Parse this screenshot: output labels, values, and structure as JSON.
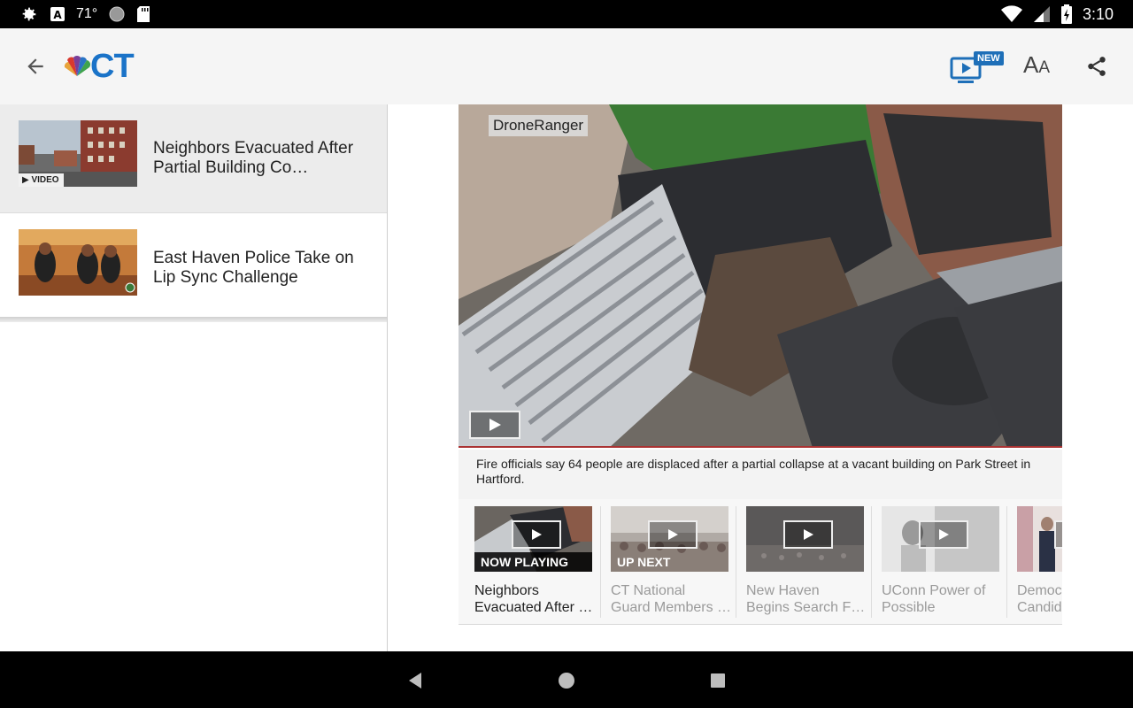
{
  "status_bar": {
    "temperature": "71°",
    "time": "3:10"
  },
  "app_bar": {
    "logo_text": "CT",
    "new_badge": "NEW",
    "font_size_big": "A",
    "font_size_small": "A"
  },
  "articles": [
    {
      "title": "Neighbors Evacuated After Partial Building Co…",
      "tag": "VIDEO",
      "active": true
    },
    {
      "title": "East Haven Police Take on Lip Sync Challenge",
      "active": false
    }
  ],
  "video": {
    "overlay_label": "DroneRanger",
    "caption": "Fire officials say 64 people are displaced after a partial collapse at a vacant building on Park Street in Hartford."
  },
  "playlist": [
    {
      "status": "NOW PLAYING",
      "title_line1": "Neighbors",
      "title_line2": "Evacuated After …"
    },
    {
      "status": "UP NEXT",
      "title_line1": "CT National",
      "title_line2": "Guard Members …"
    },
    {
      "status": "",
      "title_line1": "New Haven",
      "title_line2": "Begins Search F…"
    },
    {
      "status": "",
      "title_line1": "UConn Power of",
      "title_line2": "Possible"
    },
    {
      "status": "",
      "title_line1": "Democ",
      "title_line2": "Candid"
    }
  ],
  "colors": {
    "accent": "#1a73c8",
    "badge": "#1e6fb8",
    "status_bar": "#000000",
    "app_bar": "#f5f5f5"
  }
}
